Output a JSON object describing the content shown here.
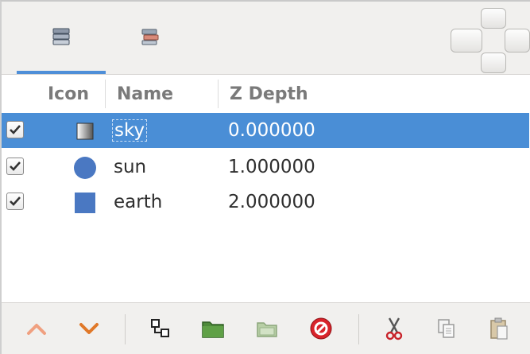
{
  "tabs": [
    {
      "icon": "layers-icon",
      "active": true
    },
    {
      "icon": "layer-transform-icon",
      "active": false
    }
  ],
  "table": {
    "columns": {
      "icon": "Icon",
      "name": "Name",
      "z_depth": "Z Depth"
    },
    "rows": [
      {
        "checked": true,
        "icon": "gradient-square-icon",
        "name": "sky",
        "z_depth": "0.000000",
        "selected": true
      },
      {
        "checked": true,
        "icon": "circle-icon",
        "name": "sun",
        "z_depth": "1.000000",
        "selected": false
      },
      {
        "checked": true,
        "icon": "square-icon",
        "name": "earth",
        "z_depth": "2.000000",
        "selected": false
      }
    ]
  },
  "toolbar": {
    "buttons": [
      "raise-layer-icon",
      "lower-layer-icon",
      "group-layers-icon",
      "folder-icon",
      "folder-disabled-icon",
      "delete-icon",
      "cut-icon",
      "copy-icon",
      "paste-icon"
    ]
  },
  "colors": {
    "selection": "#4a8ed6",
    "tab_underline": "#4f8fd8",
    "shape_blue": "#4a78c2"
  }
}
